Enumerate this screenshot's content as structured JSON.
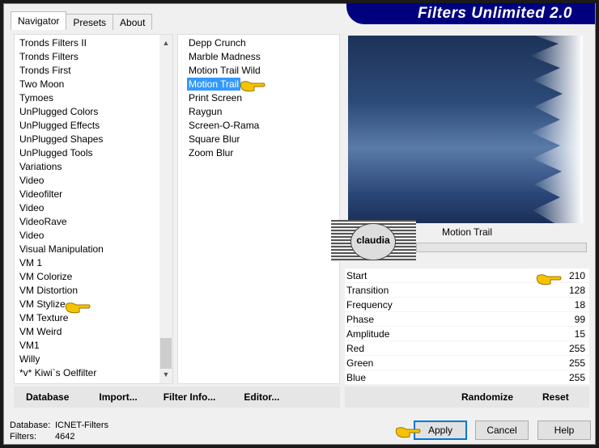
{
  "title": "Filters Unlimited 2.0",
  "tabs": [
    {
      "label": "Navigator"
    },
    {
      "label": "Presets"
    },
    {
      "label": "About"
    }
  ],
  "categories": [
    "Tronds Filters II",
    "Tronds Filters",
    "Tronds First",
    "Two Moon",
    "Tymoes",
    "UnPlugged Colors",
    "UnPlugged Effects",
    "UnPlugged Shapes",
    "UnPlugged Tools",
    "Variations",
    "Video",
    "Videofilter",
    "Video",
    "VideoRave",
    "Video",
    "Visual Manipulation",
    "VM 1",
    "VM Colorize",
    "VM Distortion",
    "VM Stylize",
    "VM Texture",
    "VM Weird",
    "VM1",
    "Willy",
    "*v* Kiwi`s Oelfilter"
  ],
  "selected_category": "VM Stylize",
  "filters": [
    "Depp Crunch",
    "Marble Madness",
    "Motion Trail Wild",
    "Motion Trail",
    "Print Screen",
    "Raygun",
    "Screen-O-Rama",
    "Square Blur",
    "Zoom Blur"
  ],
  "selected_filter": "Motion Trail",
  "filter_name": "Motion Trail",
  "watermark": "claudia",
  "params": [
    {
      "label": "Start",
      "value": "210"
    },
    {
      "label": "Transition",
      "value": "128"
    },
    {
      "label": "Frequency",
      "value": "18"
    },
    {
      "label": "Phase",
      "value": "99"
    },
    {
      "label": "Amplitude",
      "value": "15"
    },
    {
      "label": "Red",
      "value": "255"
    },
    {
      "label": "Green",
      "value": "255"
    },
    {
      "label": "Blue",
      "value": "255"
    }
  ],
  "buttons": {
    "database": "Database",
    "import": "Import...",
    "filter_info": "Filter Info...",
    "editor": "Editor...",
    "randomize": "Randomize",
    "reset": "Reset",
    "apply": "Apply",
    "cancel": "Cancel",
    "help": "Help"
  },
  "status": {
    "database_label": "Database:",
    "database_value": "ICNET-Filters",
    "filters_label": "Filters:",
    "filters_value": "4642"
  },
  "colors": {
    "banner": "#00007f",
    "selection": "#3399ff",
    "pointer": "#f5c400"
  }
}
